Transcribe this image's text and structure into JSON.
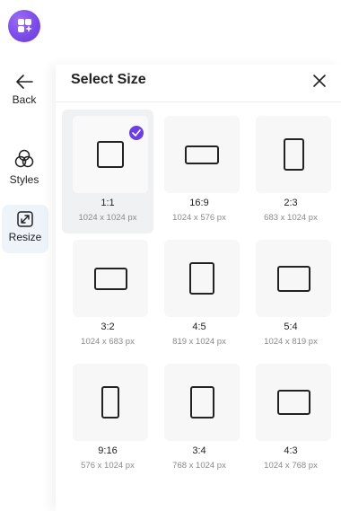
{
  "rail": {
    "back_label": "Back",
    "styles_label": "Styles",
    "resize_label": "Resize"
  },
  "panel": {
    "title": "Select Size"
  },
  "sizes": [
    {
      "ratio": "1:1",
      "dims": "1024 x 1024 px",
      "selected": true
    },
    {
      "ratio": "16:9",
      "dims": "1024 x 576 px",
      "selected": false
    },
    {
      "ratio": "2:3",
      "dims": "683 x 1024 px",
      "selected": false
    },
    {
      "ratio": "3:2",
      "dims": "1024 x 683 px",
      "selected": false
    },
    {
      "ratio": "4:5",
      "dims": "819 x 1024 px",
      "selected": false
    },
    {
      "ratio": "5:4",
      "dims": "1024 x 819 px",
      "selected": false
    },
    {
      "ratio": "9:16",
      "dims": "576 x 1024 px",
      "selected": false
    },
    {
      "ratio": "3:4",
      "dims": "768 x 1024 px",
      "selected": false
    },
    {
      "ratio": "4:3",
      "dims": "1024 x 768 px",
      "selected": false
    }
  ],
  "colors": {
    "accent": "#6d3fe0",
    "selected_bg": "#f0f1f2",
    "rail_active_bg": "#eef4fa"
  },
  "icons": {
    "logo": "app-grid-icon",
    "back": "arrow-left-icon",
    "styles": "circles-icon",
    "resize": "resize-icon",
    "close": "close-icon",
    "check": "check-icon"
  }
}
